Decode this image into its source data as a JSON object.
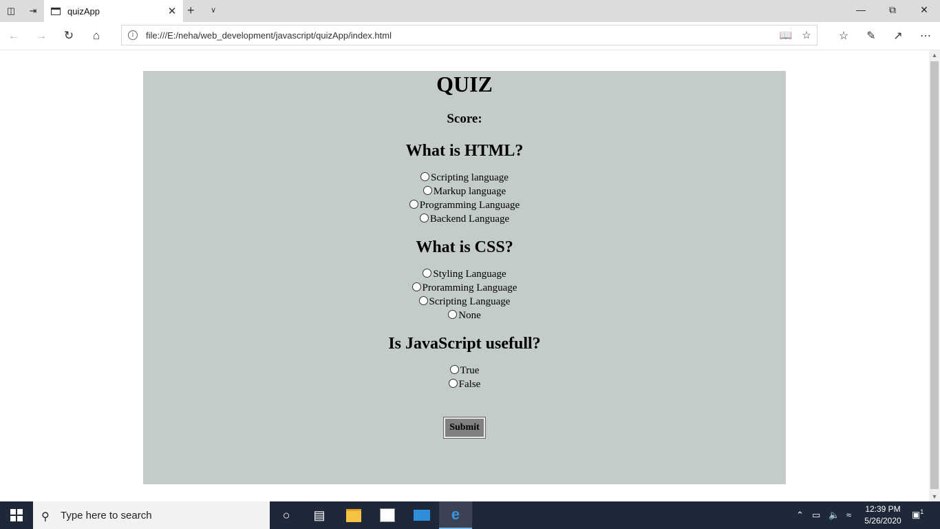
{
  "browser": {
    "tab_title": "quizApp",
    "url": "file:///E:/neha/web_development/javascript/quizApp/index.html"
  },
  "quiz": {
    "title": "QUIZ",
    "score_label": "Score:",
    "questions": [
      {
        "text": "What is HTML?",
        "options": [
          "Scripting language",
          "Markup language",
          "Programming Language",
          "Backend Language"
        ]
      },
      {
        "text": "What is CSS?",
        "options": [
          "Styling Language",
          "Proramming Language",
          "Scripting Language",
          "None"
        ]
      },
      {
        "text": "Is JavaScript usefull?",
        "options": [
          "True",
          "False"
        ]
      }
    ],
    "submit_label": "Submit"
  },
  "taskbar": {
    "search_placeholder": "Type here to search",
    "time": "12:39 PM",
    "date": "5/26/2020",
    "notification_count": "1"
  },
  "colors": {
    "quiz_background": "#c3cbcb",
    "submit_background": "#808080",
    "taskbar": "#1f2838"
  }
}
